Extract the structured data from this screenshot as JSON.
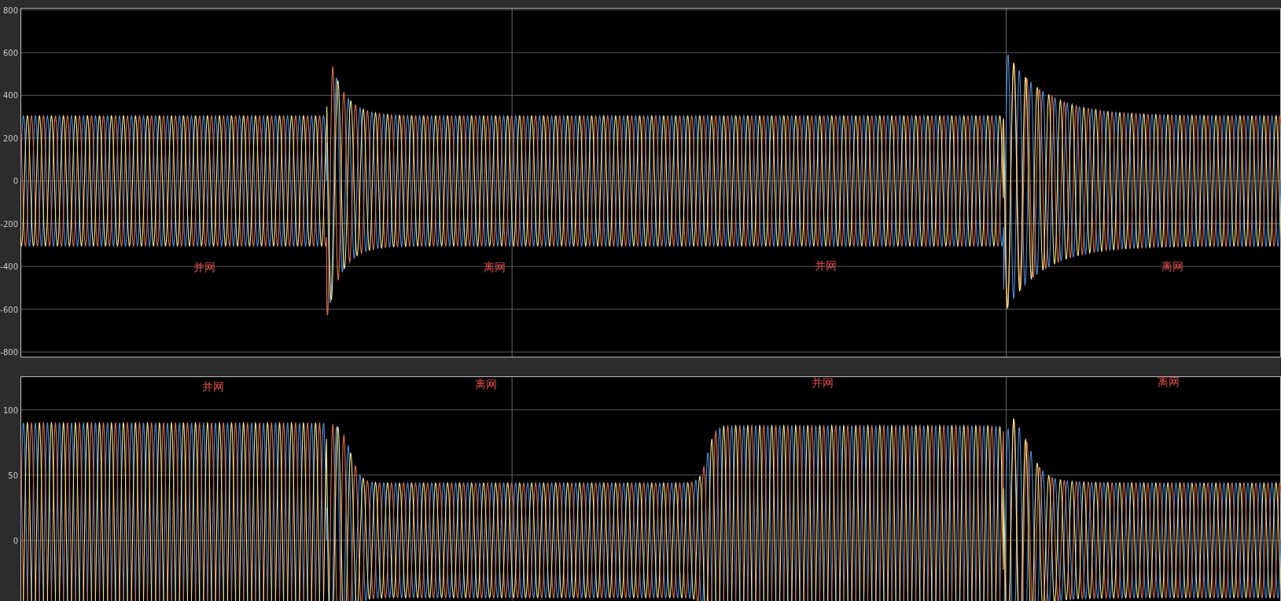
{
  "plots": [
    {
      "yticks": [
        "800",
        "600",
        "400",
        "200",
        "0",
        "-200",
        "-400",
        "-600",
        "-800"
      ],
      "traces": [
        {
          "color": "#4f8fdc"
        },
        {
          "color": "#e0734c"
        },
        {
          "color": "#f2e48a"
        }
      ],
      "annotations": [
        {
          "text": "并网"
        },
        {
          "text": "离网"
        },
        {
          "text": "并网"
        },
        {
          "text": "离网"
        }
      ]
    },
    {
      "yticks": [
        "100",
        "50",
        "0"
      ],
      "traces": [
        {
          "color": "#4f8fdc"
        },
        {
          "color": "#e0734c"
        },
        {
          "color": "#f2e48a"
        }
      ],
      "annotations": [
        {
          "text": "并网"
        },
        {
          "text": "离网"
        },
        {
          "text": "并网"
        },
        {
          "text": "离网"
        }
      ]
    }
  ]
}
